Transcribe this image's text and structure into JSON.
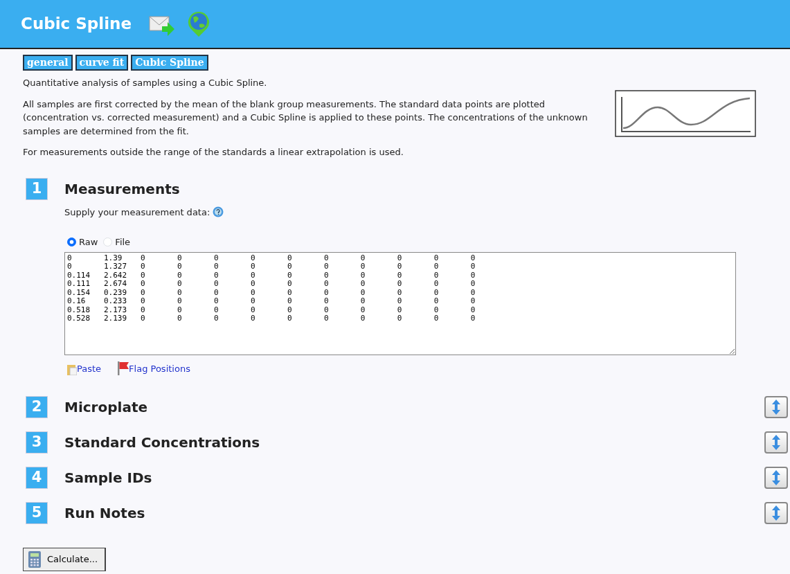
{
  "header": {
    "title": "Cubic Spline"
  },
  "tags": [
    "general",
    "curve fit",
    "Cubic Spline"
  ],
  "intro": [
    "Quantitative analysis of samples using a Cubic Spline.",
    "All samples are first corrected by the mean of the blank group measurements. The standard data points are plotted (concentration vs. corrected measurement) and a Cubic Spline is applied to these points. The concentrations of the unknown samples are determined from the fit.",
    "For measurements outside the range of the standards a linear extrapolation is used."
  ],
  "sections": [
    {
      "number": "1",
      "title": "Measurements",
      "expanded": true,
      "prompt": "Supply your measurement data:",
      "input_modes": [
        {
          "label": "Raw",
          "selected": true
        },
        {
          "label": "File",
          "selected": false
        }
      ],
      "data_rows": [
        [
          "0",
          "1.39",
          "0",
          "0",
          "0",
          "0",
          "0",
          "0",
          "0",
          "0",
          "0",
          "0"
        ],
        [
          "0",
          "1.327",
          "0",
          "0",
          "0",
          "0",
          "0",
          "0",
          "0",
          "0",
          "0",
          "0"
        ],
        [
          "0.114",
          "2.642",
          "0",
          "0",
          "0",
          "0",
          "0",
          "0",
          "0",
          "0",
          "0",
          "0"
        ],
        [
          "0.111",
          "2.674",
          "0",
          "0",
          "0",
          "0",
          "0",
          "0",
          "0",
          "0",
          "0",
          "0"
        ],
        [
          "0.154",
          "0.239",
          "0",
          "0",
          "0",
          "0",
          "0",
          "0",
          "0",
          "0",
          "0",
          "0"
        ],
        [
          "0.16",
          "0.233",
          "0",
          "0",
          "0",
          "0",
          "0",
          "0",
          "0",
          "0",
          "0",
          "0"
        ],
        [
          "0.518",
          "2.173",
          "0",
          "0",
          "0",
          "0",
          "0",
          "0",
          "0",
          "0",
          "0",
          "0"
        ],
        [
          "0.528",
          "2.139",
          "0",
          "0",
          "0",
          "0",
          "0",
          "0",
          "0",
          "0",
          "0",
          "0"
        ]
      ],
      "links": [
        {
          "kind": "paste",
          "label": "Paste"
        },
        {
          "kind": "flag",
          "label": "Flag Positions"
        }
      ]
    },
    {
      "number": "2",
      "title": "Microplate",
      "expanded": false
    },
    {
      "number": "3",
      "title": "Standard Concentrations",
      "expanded": false
    },
    {
      "number": "4",
      "title": "Sample IDs",
      "expanded": false
    },
    {
      "number": "5",
      "title": "Run Notes",
      "expanded": false
    }
  ],
  "calculate_button": "Calculate..."
}
